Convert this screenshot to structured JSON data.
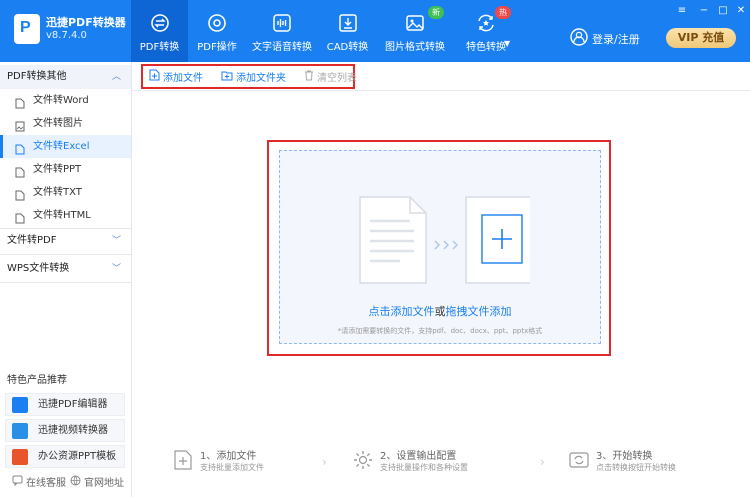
{
  "app": {
    "name": "迅捷PDF转换器",
    "version": "v8.7.4.0"
  },
  "nav": {
    "tabs": [
      {
        "label": "PDF转换",
        "icon": "swap-circle-icon"
      },
      {
        "label": "PDF操作",
        "icon": "target-icon"
      },
      {
        "label": "文字语音转换",
        "icon": "waveform-icon"
      },
      {
        "label": "CAD转换",
        "icon": "download-box-icon"
      },
      {
        "label": "图片格式转换",
        "icon": "image-icon",
        "badge": "新"
      },
      {
        "label": "特色转换",
        "icon": "star-refresh-icon",
        "badge": "热"
      }
    ]
  },
  "header": {
    "login_label": "登录/注册",
    "vip_label": "VIP 充值"
  },
  "sidebar": {
    "group_pdf": "PDF转换其他",
    "items": [
      "文件转Word",
      "文件转图片",
      "文件转Excel",
      "文件转PPT",
      "文件转TXT",
      "文件转HTML"
    ],
    "group_to_pdf": "文件转PDF",
    "group_wps": "WPS文件转换",
    "promo_title": "特色产品推荐",
    "promos": [
      "迅捷PDF编辑器",
      "迅捷视频转换器",
      "办公资源PPT模板"
    ],
    "footer": {
      "service": "在线客服",
      "website": "官网地址"
    }
  },
  "toolbar": {
    "add_file": "添加文件",
    "add_folder": "添加文件夹",
    "clear_list": "清空列表"
  },
  "dropzone": {
    "text_prefix": "点击添加文件",
    "text_or": "或",
    "text_drag": "拖拽文件添加",
    "hint": "*请添加需要转换的文件，支持pdf、doc、docx、ppt、pptx格式"
  },
  "steps": [
    {
      "title": "1、添加文件",
      "desc": "支持批量添加文件"
    },
    {
      "title": "2、设置输出配置",
      "desc": "支持批量操作和各种设置"
    },
    {
      "title": "3、开始转换",
      "desc": "点击转换按钮开始转换"
    }
  ],
  "colors": {
    "primary": "#1a7ff0",
    "highlight": "#e02a2a",
    "vip": "#eec878"
  }
}
